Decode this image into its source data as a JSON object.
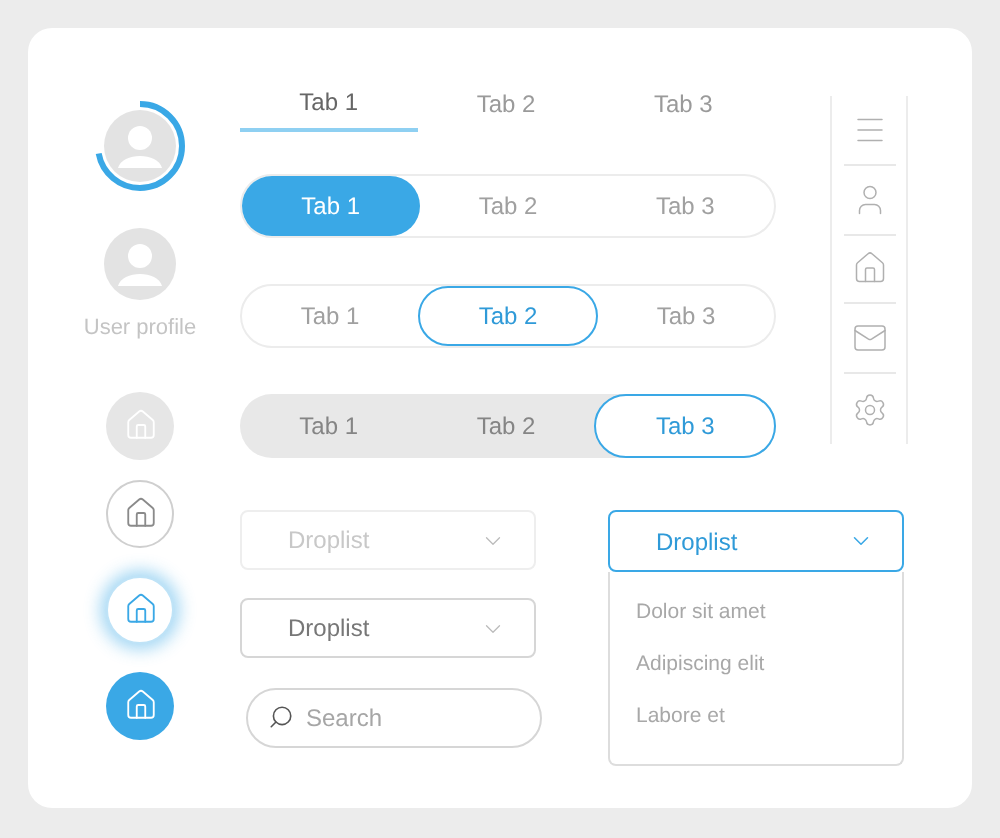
{
  "avatars": [
    {
      "kind": "progress"
    },
    {
      "kind": "plain",
      "caption": "User profile"
    }
  ],
  "home_buttons": [
    {
      "kind": "disabled"
    },
    {
      "kind": "outline"
    },
    {
      "kind": "focused"
    },
    {
      "kind": "active"
    }
  ],
  "tab_rows": [
    {
      "kind": "underline",
      "tabs": [
        {
          "label": "Tab 1",
          "selected": true
        },
        {
          "label": "Tab 2",
          "selected": false
        },
        {
          "label": "Tab 3",
          "selected": false
        }
      ]
    },
    {
      "kind": "filled",
      "tabs": [
        {
          "label": "Tab 1",
          "selected": true
        },
        {
          "label": "Tab 2",
          "selected": false
        },
        {
          "label": "Tab 3",
          "selected": false
        }
      ]
    },
    {
      "kind": "outline",
      "tabs": [
        {
          "label": "Tab 1",
          "selected": false
        },
        {
          "label": "Tab 2",
          "selected": true
        },
        {
          "label": "Tab 3",
          "selected": false
        }
      ]
    },
    {
      "kind": "segmented",
      "tabs": [
        {
          "label": "Tab 1",
          "selected": false
        },
        {
          "label": "Tab 2",
          "selected": false
        },
        {
          "label": "Tab 3",
          "selected": true
        }
      ]
    }
  ],
  "droplists": [
    {
      "label": "Droplist",
      "disabled": true
    },
    {
      "label": "Droplist",
      "disabled": false
    }
  ],
  "search": {
    "placeholder": "Search"
  },
  "open_droplist": {
    "label": "Droplist",
    "expanded": true,
    "options": [
      "Dolor sit amet",
      "Adipiscing elit",
      "Labore et"
    ]
  }
}
